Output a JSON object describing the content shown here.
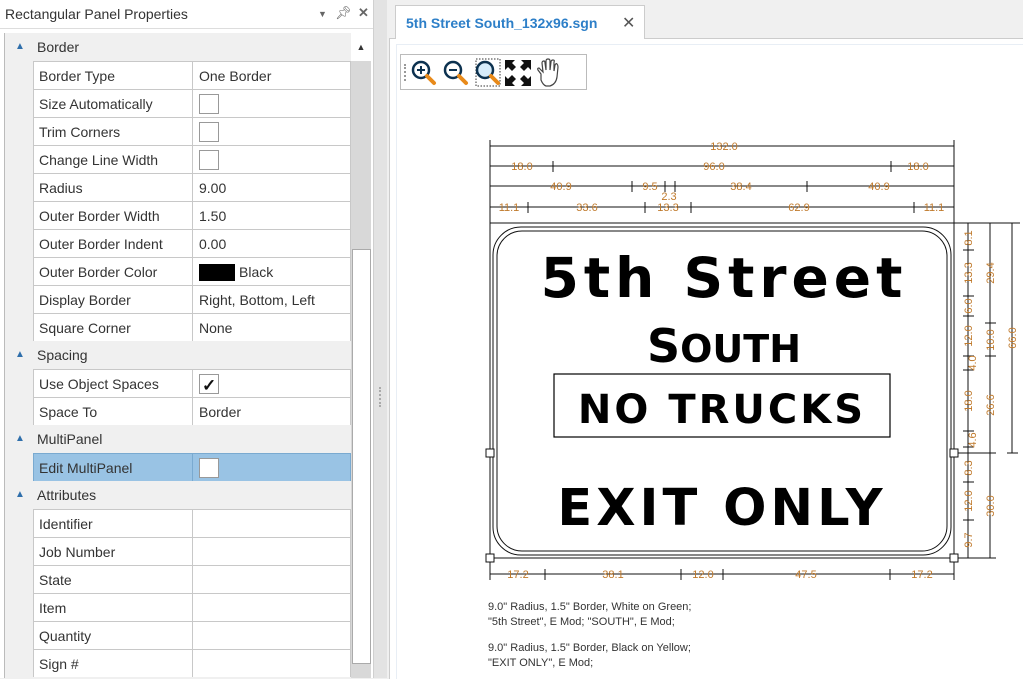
{
  "properties_panel": {
    "title": "Rectangular Panel Properties",
    "header_icons": [
      "dropdown-arrow-icon",
      "pin-icon",
      "close-icon"
    ],
    "categories": [
      {
        "label": "Border",
        "rows": [
          {
            "name": "Border Type",
            "type": "text",
            "value": "One Border"
          },
          {
            "name": "Size Automatically",
            "type": "checkbox",
            "checked": false
          },
          {
            "name": "Trim Corners",
            "type": "checkbox",
            "checked": false
          },
          {
            "name": "Change Line Width",
            "type": "checkbox",
            "checked": false
          },
          {
            "name": "Radius",
            "type": "text",
            "value": "9.00"
          },
          {
            "name": "Outer Border Width",
            "type": "text",
            "value": "1.50"
          },
          {
            "name": "Outer Border Indent",
            "type": "text",
            "value": "0.00"
          },
          {
            "name": "Outer Border Color",
            "type": "color",
            "value": "Black",
            "color": "#000000"
          },
          {
            "name": "Display Border",
            "type": "text",
            "value": "Right, Bottom, Left"
          },
          {
            "name": "Square Corner",
            "type": "text",
            "value": "None"
          }
        ]
      },
      {
        "label": "Spacing",
        "rows": [
          {
            "name": "Use Object Spaces",
            "type": "checkbox",
            "checked": true
          },
          {
            "name": "Space To",
            "type": "text",
            "value": "Border"
          }
        ]
      },
      {
        "label": "MultiPanel",
        "rows": [
          {
            "name": "Edit MultiPanel",
            "type": "checkbox",
            "checked": false,
            "selected": true
          }
        ]
      },
      {
        "label": "Attributes",
        "rows": [
          {
            "name": "Identifier",
            "type": "text",
            "value": ""
          },
          {
            "name": "Job Number",
            "type": "text",
            "value": ""
          },
          {
            "name": "State",
            "type": "text",
            "value": ""
          },
          {
            "name": "Item",
            "type": "text",
            "value": ""
          },
          {
            "name": "Quantity",
            "type": "text",
            "value": ""
          },
          {
            "name": "Sign #",
            "type": "text",
            "value": ""
          }
        ]
      }
    ]
  },
  "document": {
    "tab_title": "5th Street South_132x96.sgn",
    "tab_close": "✕",
    "toolbar": [
      "zoom-in",
      "zoom-out",
      "zoom-window",
      "zoom-extents",
      "pan"
    ]
  },
  "sign": {
    "line1": "5th Street",
    "line2_first": "S",
    "line2_rest": "OUTH",
    "line3": "NO TRUCKS",
    "line4": "EXIT ONLY",
    "dims_top": {
      "row1": [
        "132.0"
      ],
      "row2": [
        "18.0",
        "96.0",
        "18.0"
      ],
      "row3": [
        "40.9",
        "9.5",
        "2.3",
        "38.4",
        "40.9"
      ],
      "row4": [
        "11.1",
        "33.6",
        "13.3",
        "62.9",
        "11.1"
      ]
    },
    "dims_bottom": [
      "17.2",
      "38.1",
      "12.0",
      "47.5",
      "17.2"
    ],
    "dims_right_col1": [
      "8.1",
      "13.3",
      "6.0",
      "12.0",
      "4.0",
      "18.0",
      "4.6",
      "8.3",
      "12.0",
      "9.7"
    ],
    "dims_right_col2": [
      "29.4",
      "10.0",
      "26.6",
      "30.0"
    ],
    "dims_right_col3": [
      "66.0"
    ],
    "notes": [
      [
        "9.0\" Radius, 1.5\" Border, White on Green;",
        "\"5th Street\",  E Mod; \"SOUTH\",  E Mod;"
      ],
      [
        "9.0\" Radius, 1.5\" Border, Black on Yellow;",
        "\"EXIT ONLY\",  E Mod;"
      ]
    ]
  }
}
